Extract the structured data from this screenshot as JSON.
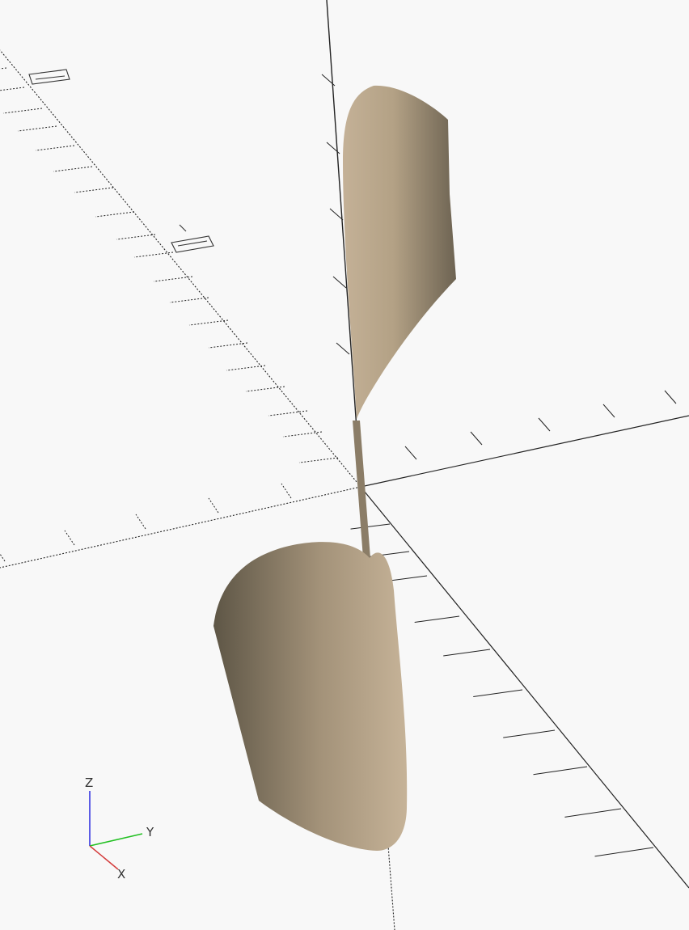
{
  "viewport": {
    "background_color": "#f8f8f8",
    "model_color": "#c4b197",
    "model_shadow_color": "#6d6352",
    "axis_color": "#222222"
  },
  "axis_indicator": {
    "x_label": "X",
    "y_label": "Y",
    "z_label": "Z",
    "x_color": "#d43c3c",
    "y_color": "#22c022",
    "z_color": "#2a2ae0"
  }
}
